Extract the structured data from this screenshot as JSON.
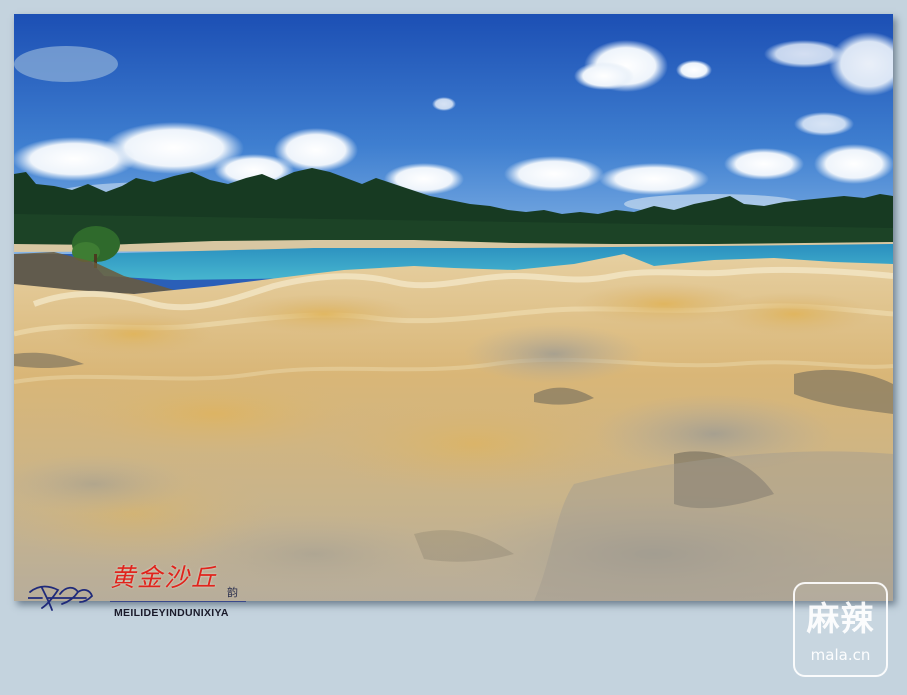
{
  "photo": {
    "subject": "golden-sand-dunes-beside-lake",
    "palette": {
      "sky_top": "#1f55b8",
      "sky_horizon": "#6fa6df",
      "treeline": "#16361f",
      "lake": "#3aa8c8",
      "sand_light": "#e9dcbc",
      "sand_gold": "#d4a74e",
      "sand_grey": "#a9a293"
    }
  },
  "signature": {
    "title": "黄金沙丘",
    "suffix": "韵",
    "subtitle": "MEILIDEYINDUNIXIYA"
  },
  "watermark": {
    "chars": "麻辣",
    "domain": "mala.cn"
  }
}
